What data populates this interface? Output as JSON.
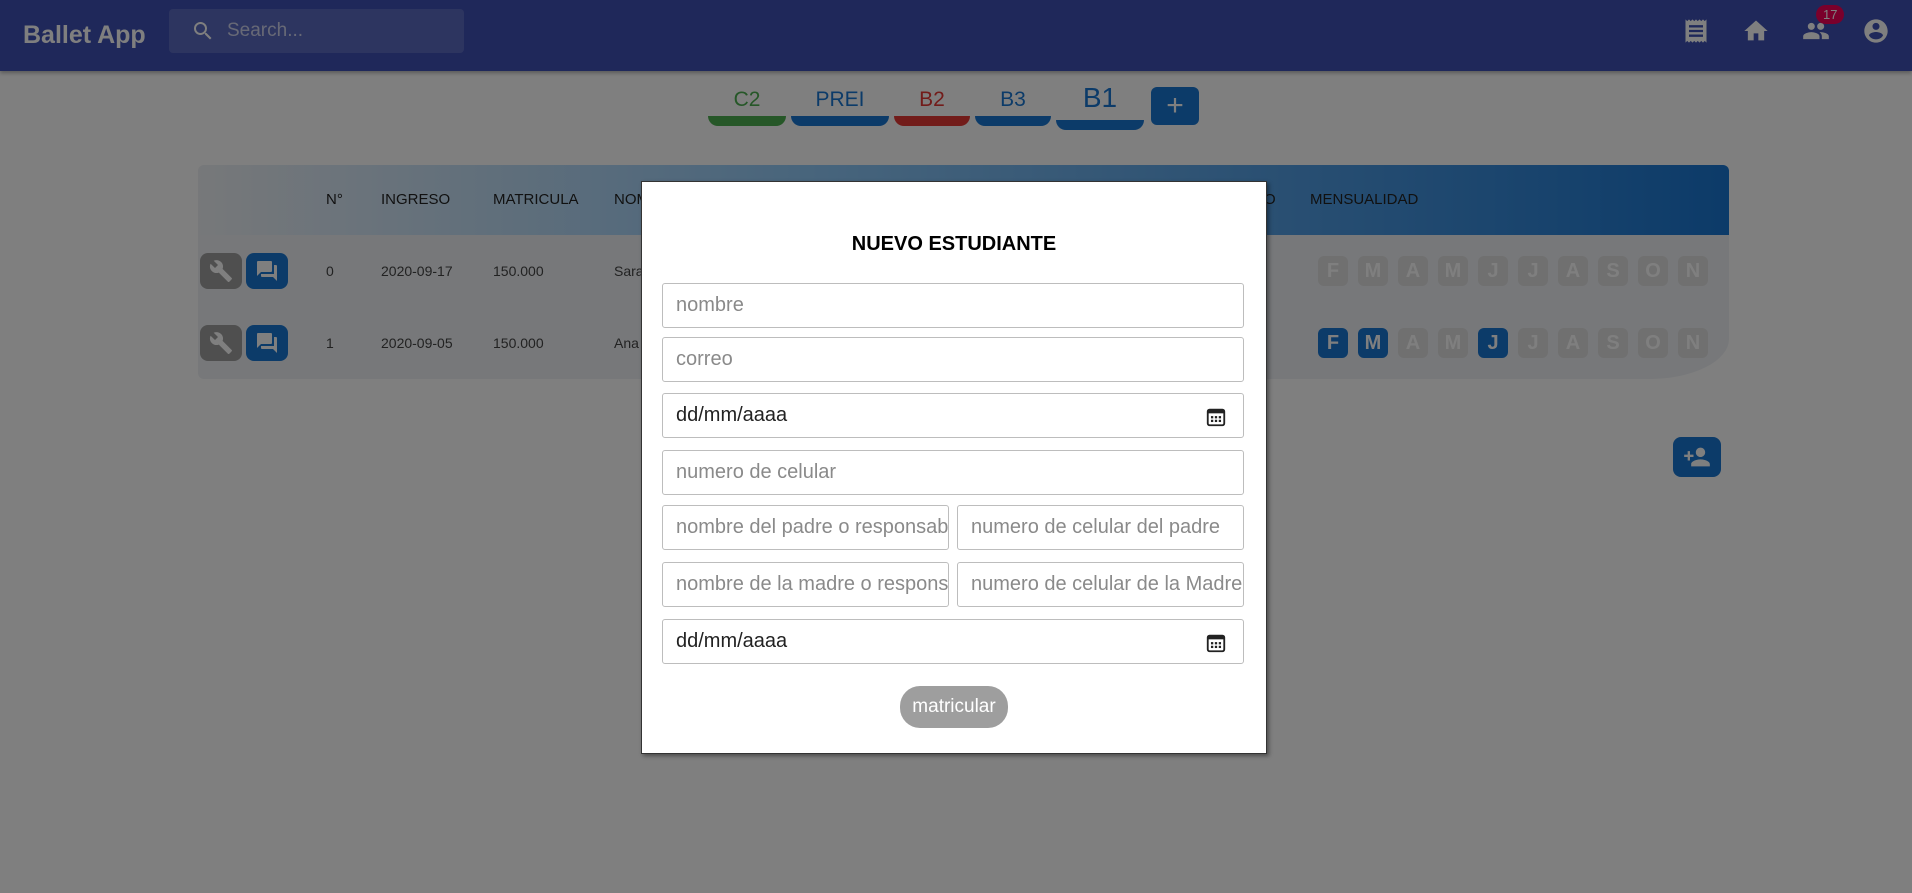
{
  "appbar": {
    "title": "Ballet App",
    "search_placeholder": "Search...",
    "badge_count": "17",
    "icons": [
      "receipt-icon",
      "home-icon",
      "people-icon",
      "account-icon"
    ]
  },
  "tabs": [
    {
      "label": "C2",
      "color": "#4caf50"
    },
    {
      "label": "PREI",
      "color": "#1976d2"
    },
    {
      "label": "B2",
      "color": "#e53935"
    },
    {
      "label": "B3",
      "color": "#1976d2"
    },
    {
      "label": "B1",
      "color": "#1976d2"
    }
  ],
  "add_tab_label": "+",
  "table": {
    "headers": {
      "n": "N°",
      "ingreso": "INGRESO",
      "matricula": "MATRICULA",
      "nombre": "NOM",
      "o": "O",
      "mensualidad": "MENSUALIDAD"
    },
    "rows": [
      {
        "n": "0",
        "ingreso": "2020-09-17",
        "matricula": "150.000",
        "nombre": "Sara",
        "months_paid": [
          false,
          false,
          false,
          false,
          false,
          false,
          false,
          false,
          false,
          false
        ]
      },
      {
        "n": "1",
        "ingreso": "2020-09-05",
        "matricula": "150.000",
        "nombre": "Ana",
        "months_paid": [
          true,
          true,
          false,
          false,
          true,
          false,
          false,
          false,
          false,
          false
        ]
      }
    ],
    "months": [
      "F",
      "M",
      "A",
      "M",
      "J",
      "J",
      "A",
      "S",
      "O",
      "N"
    ]
  },
  "modal": {
    "title": "NUEVO ESTUDIANTE",
    "nombre_placeholder": "nombre",
    "correo_placeholder": "correo",
    "fecha_nacimiento_text": "dd/mm/aaaa",
    "celular_placeholder": "numero de celular",
    "padre_placeholder": "nombre del padre o responsable",
    "padre_celular_placeholder": "numero de celular del padre",
    "madre_placeholder": "nombre de la madre o responsable",
    "madre_celular_placeholder": "numero de celular de la Madre",
    "fecha_ingreso_text": "dd/mm/aaaa",
    "submit_label": "matricular"
  }
}
